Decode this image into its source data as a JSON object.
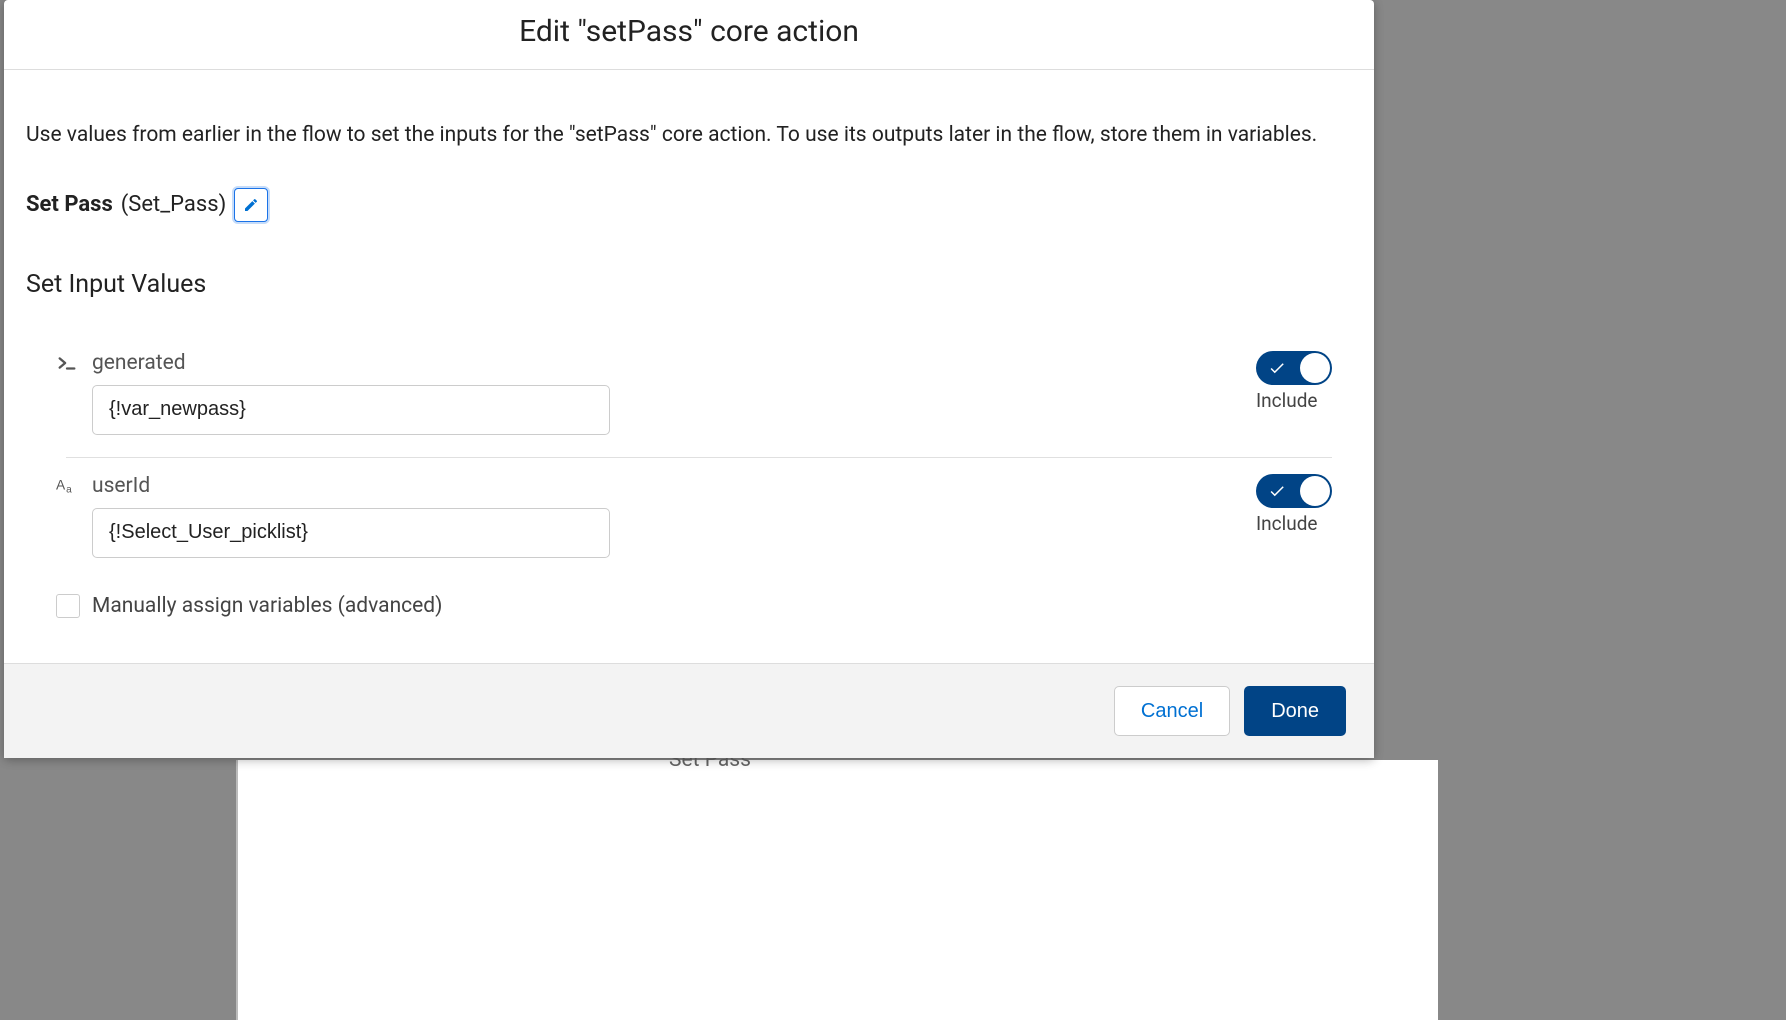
{
  "modal": {
    "title": "Edit \"setPass\" core action",
    "description": "Use values from earlier in the flow to set the inputs for the \"setPass\" core action. To use its outputs later in the flow, store them in variables.",
    "element_label": "Set Pass",
    "element_api": "(Set_Pass)",
    "section_heading": "Set Input Values",
    "inputs": [
      {
        "label": "generated",
        "value": "{!var_newpass}",
        "toggle_label": "Include"
      },
      {
        "label": "userId",
        "value": "{!Select_User_picklist}",
        "toggle_label": "Include"
      }
    ],
    "advanced_checkbox": "Manually assign variables (advanced)",
    "footer": {
      "cancel": "Cancel",
      "done": "Done"
    }
  },
  "background": {
    "node_label": "Set Pass"
  }
}
